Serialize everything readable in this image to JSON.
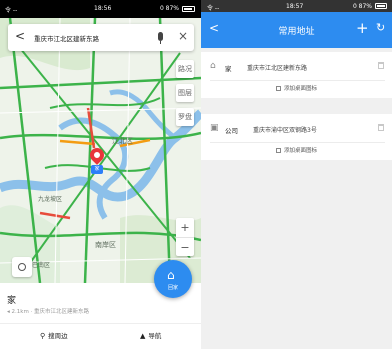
{
  "left_screen": {
    "status_bar": {
      "left": "令 --",
      "time": "18:56",
      "right": "0 87%"
    },
    "search": {
      "back_glyph": "<",
      "value": "重庆市江北区建新东路",
      "close_glyph": "×"
    },
    "map": {
      "labels": [
        "江北区",
        "九龙坡区",
        "南岸区",
        "巴南区"
      ],
      "tools": [
        "路况",
        "图层",
        "罗盘"
      ],
      "zoom_in": "+",
      "zoom_out": "−",
      "pin_badge": "家"
    },
    "home_fab": {
      "glyph": "⌂",
      "label": "回家"
    },
    "place": {
      "name": "家",
      "meta": "◂ 2.1km  ·  重庆市江北区建新东路",
      "actions": [
        {
          "icon": "⚲",
          "label": "搜周边"
        },
        {
          "icon": "▲",
          "label": "导航"
        }
      ]
    }
  },
  "right_screen": {
    "status_bar": {
      "left": "令 --",
      "time": "18:57",
      "right": "0 87%"
    },
    "topbar": {
      "back_glyph": "<",
      "title": "常用地址",
      "plus_glyph": "+",
      "refresh_glyph": "↻"
    },
    "favorites": [
      {
        "icon": "⌂",
        "label": "家",
        "address": "重庆市江北区建新东路",
        "shortcut": "添加桌面图标"
      },
      {
        "icon": "▣",
        "label": "公司",
        "address": "重庆市渝中区双钢路3号",
        "shortcut": "添加桌面图标"
      }
    ]
  },
  "colors": {
    "accent": "#2d8cf0",
    "pin": "#e8343a",
    "road": "#3cb34a",
    "river": "#8cc0ea"
  }
}
